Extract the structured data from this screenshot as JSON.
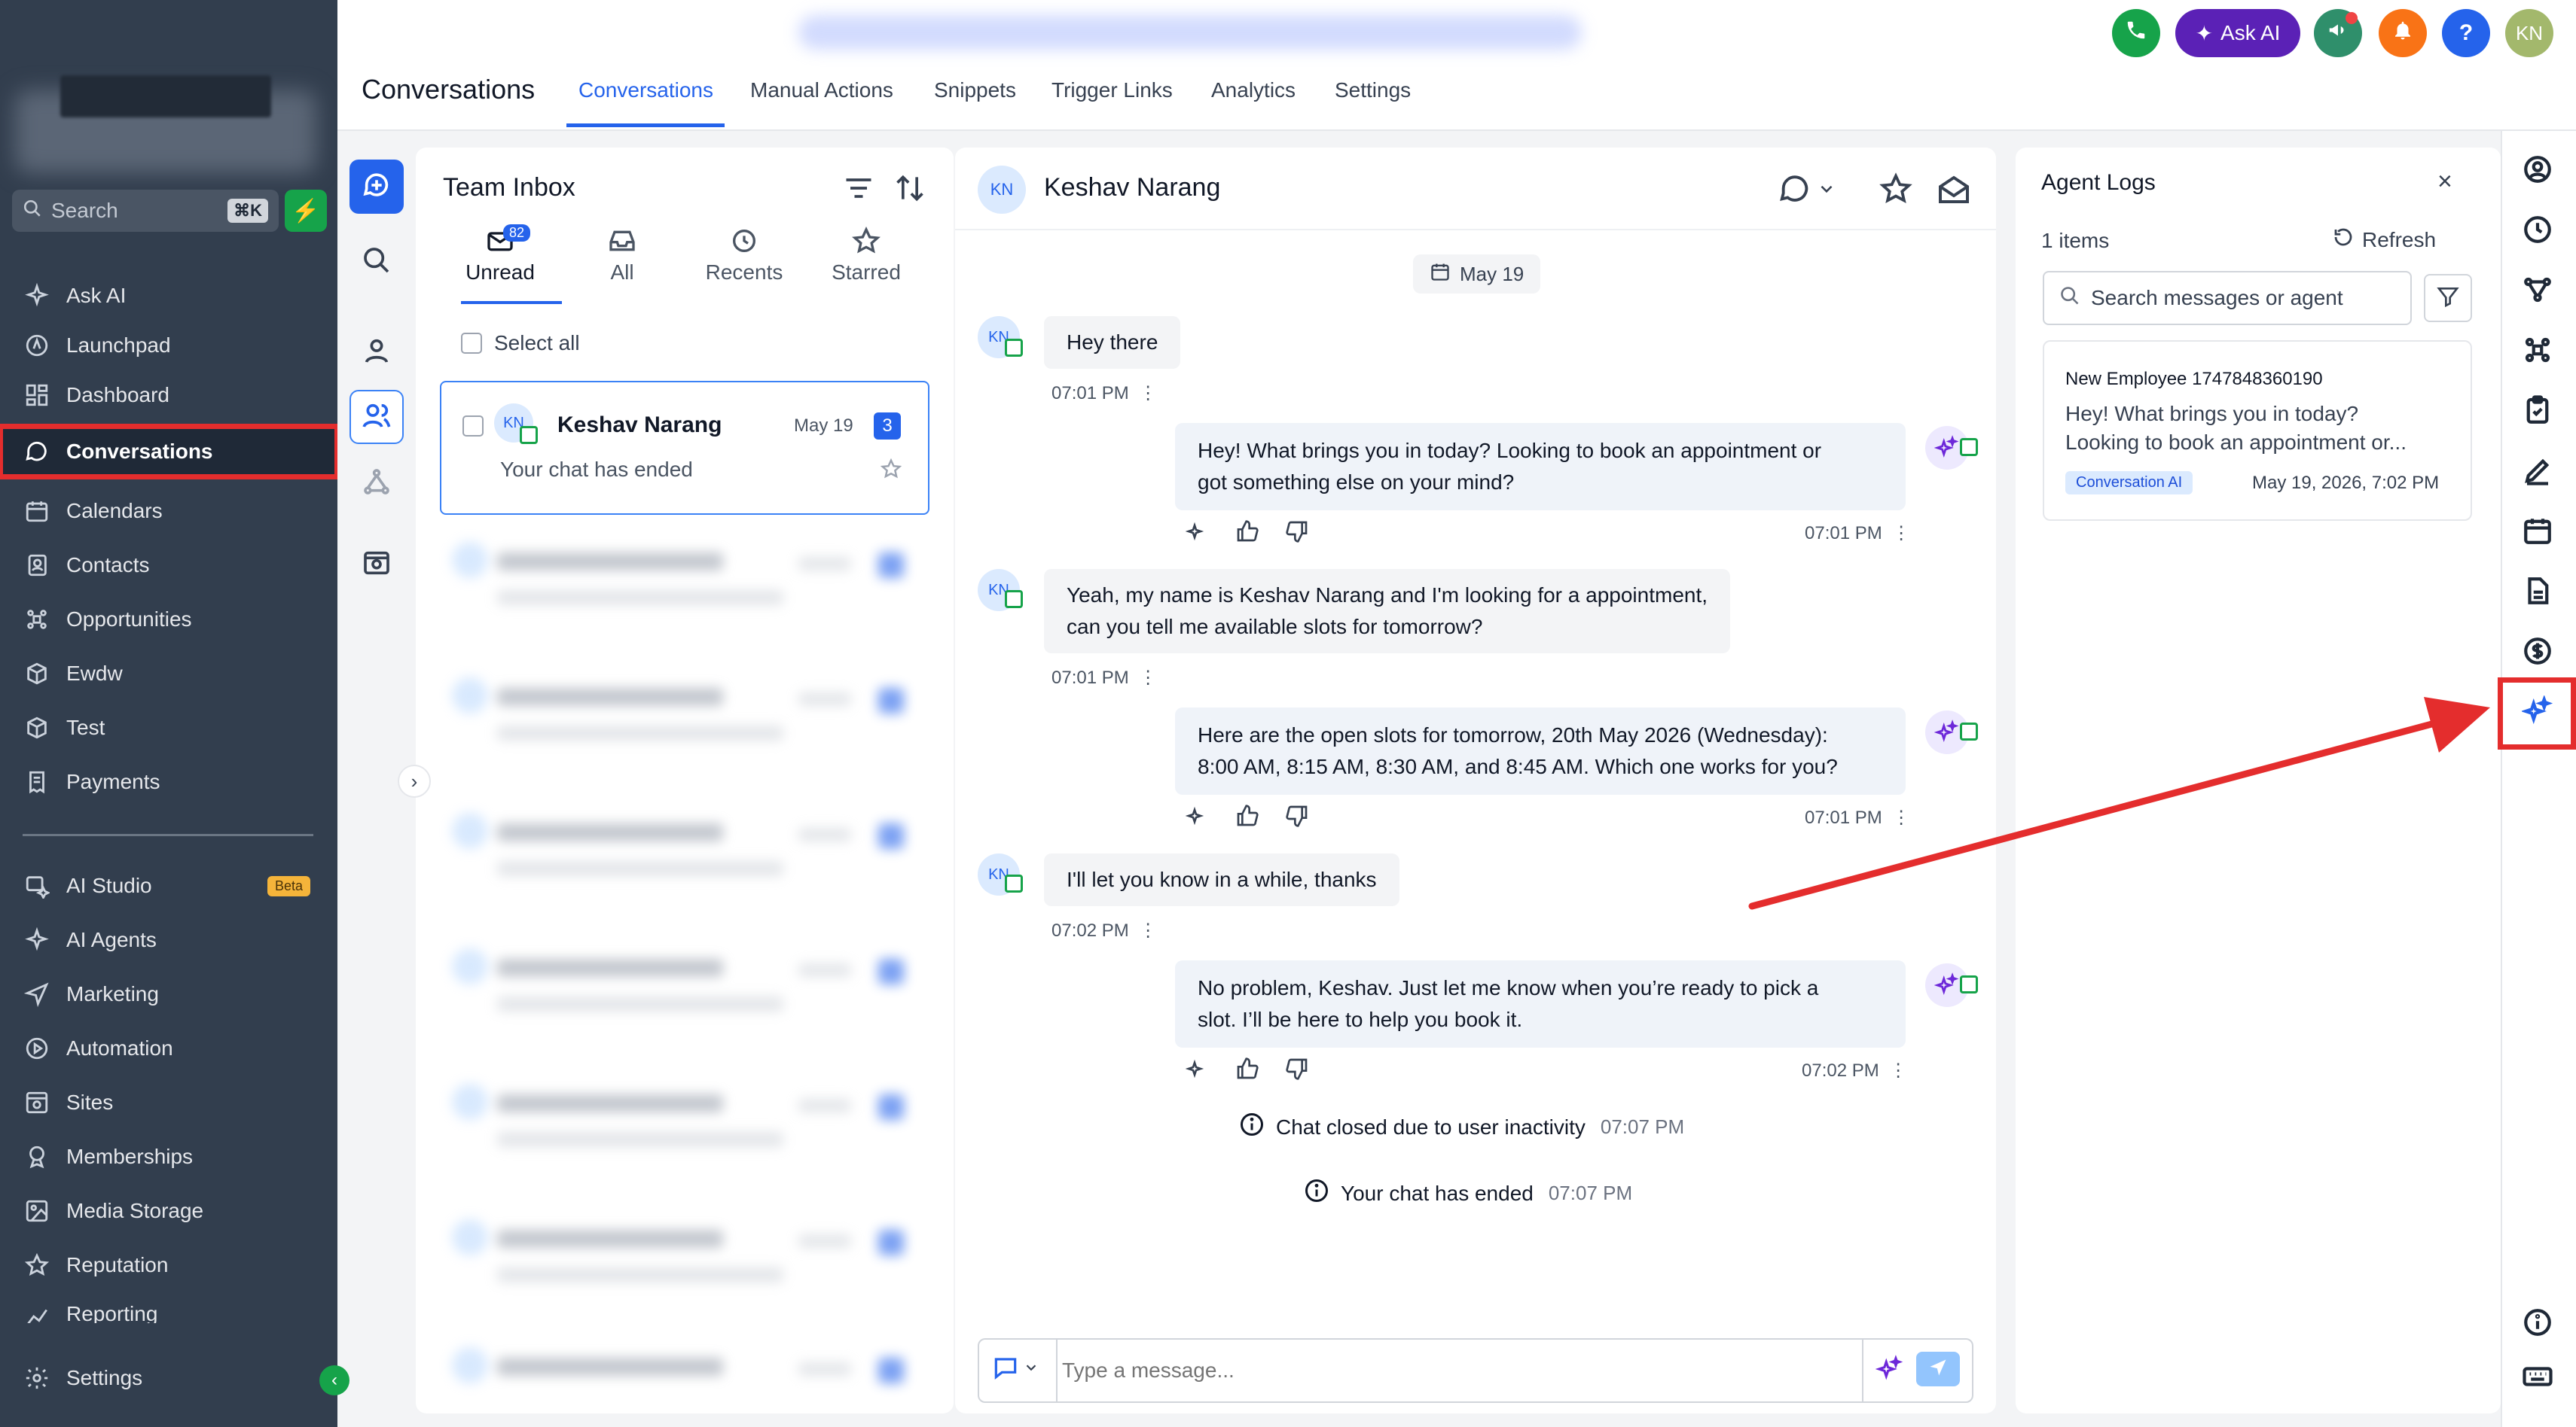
{
  "sidebar": {
    "search_placeholder": "Search",
    "search_shortcut": "⌘K",
    "items": [
      {
        "label": "Ask AI",
        "icon": "sparkle-icon"
      },
      {
        "label": "Launchpad",
        "icon": "rocket-icon"
      },
      {
        "label": "Dashboard",
        "icon": "grid-icon"
      },
      {
        "label": "Conversations",
        "icon": "chat-bubble-icon",
        "active": true
      },
      {
        "label": "Calendars",
        "icon": "calendar-icon"
      },
      {
        "label": "Contacts",
        "icon": "contacts-icon"
      },
      {
        "label": "Opportunities",
        "icon": "opportunities-icon"
      },
      {
        "label": "Ewdw",
        "icon": "cube-icon"
      },
      {
        "label": "Test",
        "icon": "cube-icon"
      },
      {
        "label": "Payments",
        "icon": "receipt-icon"
      }
    ],
    "items2": [
      {
        "label": "AI Studio",
        "icon": "ai-studio-icon",
        "badge": "Beta"
      },
      {
        "label": "AI Agents",
        "icon": "sparkle-icon"
      },
      {
        "label": "Marketing",
        "icon": "send-icon"
      },
      {
        "label": "Automation",
        "icon": "automation-icon"
      },
      {
        "label": "Sites",
        "icon": "sites-icon"
      },
      {
        "label": "Memberships",
        "icon": "membership-icon"
      },
      {
        "label": "Media Storage",
        "icon": "image-icon"
      },
      {
        "label": "Reputation",
        "icon": "star-icon"
      },
      {
        "label": "Reporting",
        "icon": "chart-icon"
      }
    ],
    "settings_label": "Settings"
  },
  "topbar": {
    "title": "Conversations",
    "tabs": [
      "Conversations",
      "Manual Actions",
      "Snippets",
      "Trigger Links",
      "Analytics",
      "Settings"
    ],
    "ask_ai_label": "Ask AI",
    "help_label": "?",
    "user_initials": "KN"
  },
  "inbox": {
    "title": "Team Inbox",
    "filters": [
      {
        "label": "Unread",
        "count": "82"
      },
      {
        "label": "All"
      },
      {
        "label": "Recents"
      },
      {
        "label": "Starred"
      }
    ],
    "select_all": "Select all",
    "conversation": {
      "initials": "KN",
      "name": "Keshav Narang",
      "date": "May 19",
      "count": "3",
      "preview": "Your chat has ended"
    }
  },
  "chat": {
    "contact_initials": "KN",
    "contact_name": "Keshav Narang",
    "date": "May 19",
    "messages": [
      {
        "dir": "in",
        "text": "Hey there",
        "time": "07:01 PM"
      },
      {
        "dir": "out",
        "line1": "Hey! What brings you in today? Looking to book an appointment or",
        "line2": "got something else on your mind?",
        "time": "07:01 PM"
      },
      {
        "dir": "in",
        "line1": "Yeah, my name is Keshav Narang and I'm looking for a appointment,",
        "line2": "can you tell me available slots for tomorrow?",
        "time": "07:01 PM"
      },
      {
        "dir": "out",
        "line1": "Here are the open slots for tomorrow, 20th May 2026 (Wednesday):",
        "line2": "8:00 AM, 8:15 AM, 8:30 AM, and 8:45 AM. Which one works for you?",
        "time": "07:01 PM"
      },
      {
        "dir": "in",
        "text": "I'll let you know in a while, thanks",
        "time": "07:02 PM"
      },
      {
        "dir": "out",
        "line1": "No problem, Keshav. Just let me know when you’re ready to pick a",
        "line2": "slot. I’ll be here to help you book it.",
        "time": "07:02 PM"
      }
    ],
    "system": [
      {
        "text": "Chat closed due to user inactivity",
        "time": "07:07 PM"
      },
      {
        "text": "Your chat has ended",
        "time": "07:07 PM"
      }
    ],
    "composer_placeholder": "Type a message..."
  },
  "agent_logs": {
    "title": "Agent Logs",
    "count": "1 items",
    "refresh": "Refresh",
    "search_placeholder": "Search messages or agent",
    "log": {
      "title": "New Employee 1747848360190",
      "line1": "Hey! What brings you in today?",
      "line2": "Looking to book an appointment or...",
      "tag": "Conversation AI",
      "datetime": "May 19, 2026, 7:02 PM"
    }
  },
  "colors": {
    "sidebar_bg": "#323e4e",
    "accent": "#2563eb",
    "highlight": "#e42d2d",
    "phone_button": "#16a34a",
    "ask_ai_button": "#5b21b6"
  }
}
